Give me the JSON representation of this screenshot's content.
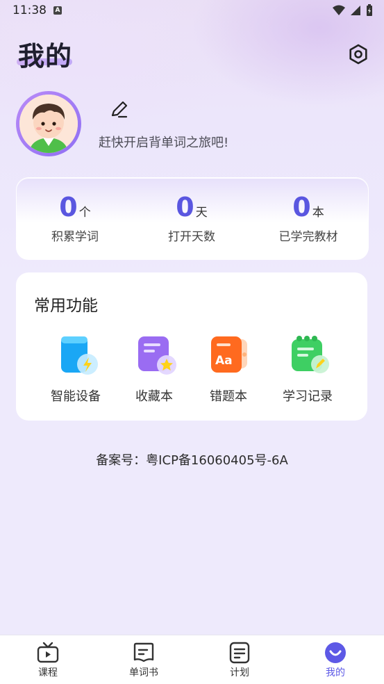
{
  "status_bar": {
    "time": "11:38",
    "notif_letter": "A"
  },
  "header": {
    "title": "我的"
  },
  "profile": {
    "slogan": "赶快开启背单词之旅吧!"
  },
  "stats": [
    {
      "value": "0",
      "unit": "个",
      "label": "积累学词"
    },
    {
      "value": "0",
      "unit": "天",
      "label": "打开天数"
    },
    {
      "value": "0",
      "unit": "本",
      "label": "已学完教材"
    }
  ],
  "functions": {
    "title": "常用功能",
    "items": [
      {
        "label": "智能设备",
        "icon": "smart-device-icon"
      },
      {
        "label": "收藏本",
        "icon": "favorites-icon"
      },
      {
        "label": "错题本",
        "icon": "wrong-book-icon"
      },
      {
        "label": "学习记录",
        "icon": "study-record-icon"
      }
    ]
  },
  "icp": "备案号：粤ICP备16060405号-6A",
  "nav": [
    {
      "label": "课程",
      "icon": "tv-icon"
    },
    {
      "label": "单词书",
      "icon": "word-book-icon"
    },
    {
      "label": "计划",
      "icon": "plan-icon"
    },
    {
      "label": "我的",
      "icon": "profile-smile-icon",
      "active": true
    }
  ],
  "colors": {
    "accent": "#5d59e6",
    "background": "#eeeafc"
  }
}
